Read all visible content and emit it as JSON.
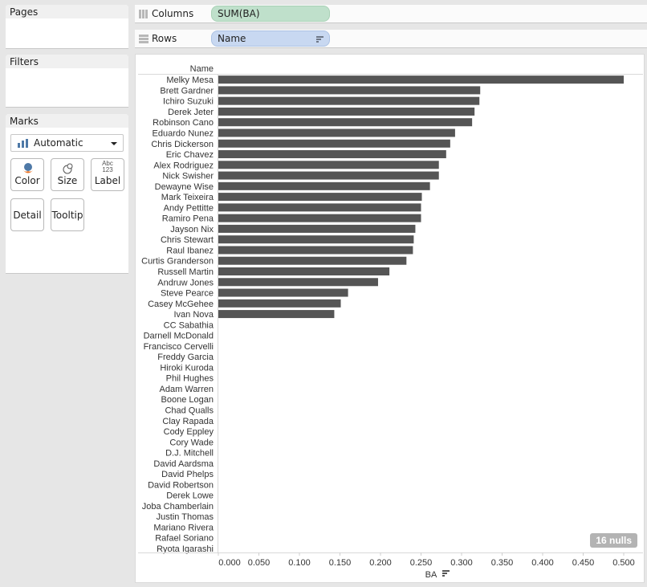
{
  "panels": {
    "pages": "Pages",
    "filters": "Filters",
    "marks": {
      "title": "Marks",
      "mark_type": "Automatic",
      "buttons": {
        "color": "Color",
        "size": "Size",
        "label": "Label",
        "label_icon_top": "Abc",
        "label_icon_bottom": "123",
        "detail": "Detail",
        "tooltip": "Tooltip"
      }
    }
  },
  "shelves": {
    "columns": {
      "label": "Columns",
      "pill": "SUM(BA)"
    },
    "rows": {
      "label": "Rows",
      "pill": "Name"
    }
  },
  "nulls_badge": "16 nulls",
  "colors": {
    "bar": "#555555",
    "columns_pill": "#bfe0cb",
    "rows_pill": "#c8d8f1"
  },
  "chart_data": {
    "type": "bar",
    "orientation": "horizontal",
    "title": "",
    "row_header": "Name",
    "xlabel": "BA",
    "ylabel": "Name",
    "xlim": [
      0,
      0.5
    ],
    "ticks": [
      "0.000",
      "0.050",
      "0.100",
      "0.150",
      "0.200",
      "0.250",
      "0.300",
      "0.350",
      "0.400",
      "0.450",
      "0.500"
    ],
    "tick_values": [
      0,
      0.05,
      0.1,
      0.15,
      0.2,
      0.25,
      0.3,
      0.35,
      0.4,
      0.45,
      0.5
    ],
    "grid": false,
    "categories": [
      "Melky Mesa",
      "Brett Gardner",
      "Ichiro Suzuki",
      "Derek Jeter",
      "Robinson Cano",
      "Eduardo Nunez",
      "Chris Dickerson",
      "Eric Chavez",
      "Alex Rodriguez",
      "Nick Swisher",
      "Dewayne Wise",
      "Mark Teixeira",
      "Andy Pettitte",
      "Ramiro Pena",
      "Jayson Nix",
      "Chris Stewart",
      "Raul Ibanez",
      "Curtis Granderson",
      "Russell Martin",
      "Andruw Jones",
      "Steve Pearce",
      "Casey McGehee",
      "Ivan Nova",
      "CC Sabathia",
      "Darnell McDonald",
      "Francisco Cervelli",
      "Freddy Garcia",
      "Hiroki Kuroda",
      "Phil Hughes",
      "Adam Warren",
      "Boone Logan",
      "Chad Qualls",
      "Clay Rapada",
      "Cody Eppley",
      "Cory Wade",
      "D.J. Mitchell",
      "David Aardsma",
      "David Phelps",
      "David Robertson",
      "Derek Lowe",
      "Joba Chamberlain",
      "Justin Thomas",
      "Mariano Rivera",
      "Rafael Soriano",
      "Ryota Igarashi"
    ],
    "values": [
      0.5,
      0.323,
      0.322,
      0.316,
      0.313,
      0.292,
      0.286,
      0.281,
      0.272,
      0.272,
      0.261,
      0.251,
      0.25,
      0.25,
      0.243,
      0.241,
      0.24,
      0.232,
      0.211,
      0.197,
      0.16,
      0.151,
      0.143,
      null,
      null,
      null,
      null,
      null,
      null,
      null,
      null,
      null,
      null,
      null,
      null,
      null,
      null,
      null,
      null,
      null,
      null,
      null,
      null,
      null,
      null
    ]
  }
}
